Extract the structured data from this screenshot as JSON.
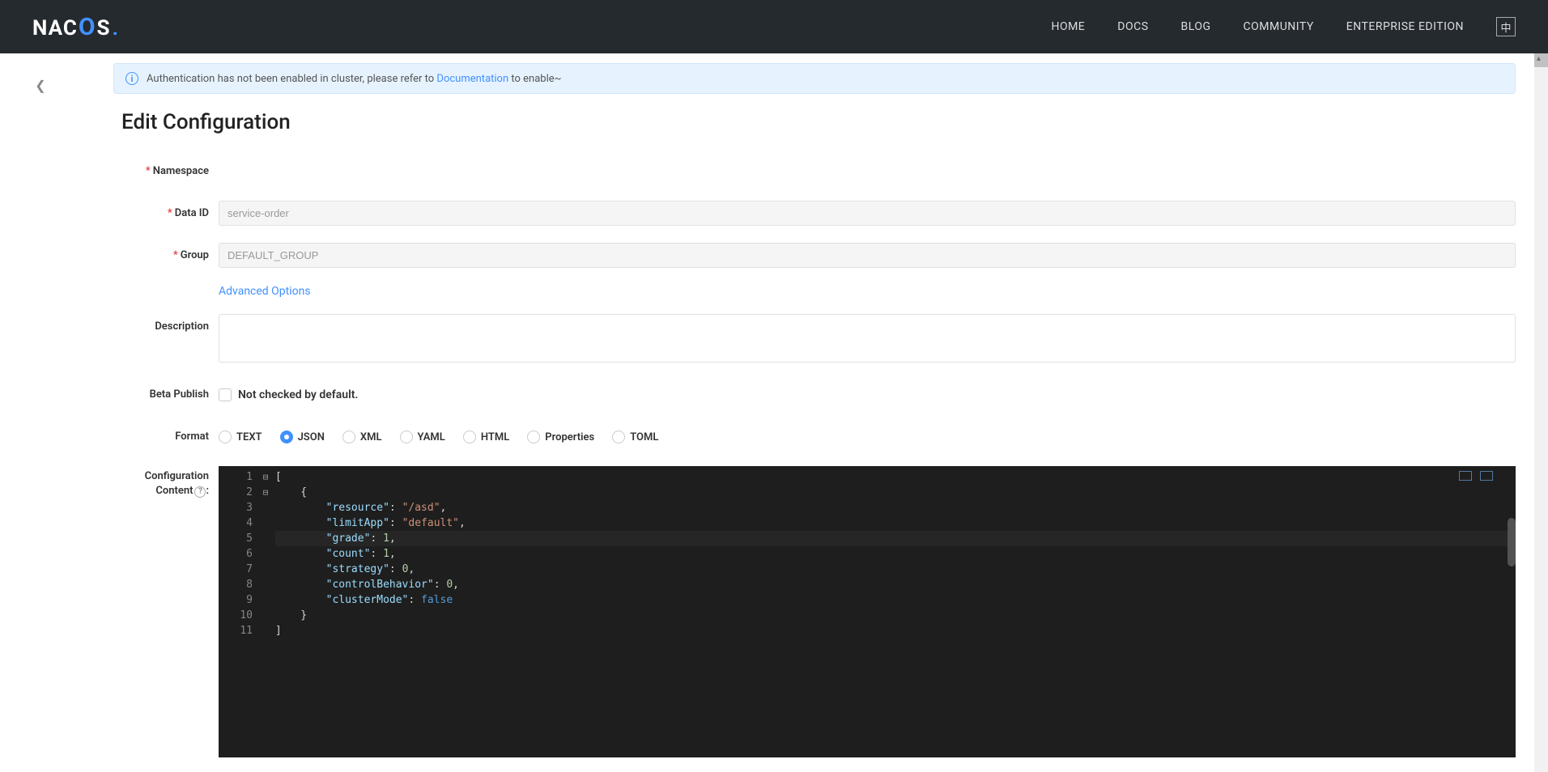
{
  "brand": "NACOS",
  "nav": {
    "home": "HOME",
    "docs": "DOCS",
    "blog": "BLOG",
    "community": "COMMUNITY",
    "enterprise": "ENTERPRISE EDITION",
    "lang": "中"
  },
  "alert": {
    "prefix": "Authentication has not been enabled in cluster, please refer to ",
    "link": "Documentation",
    "suffix": " to enable~"
  },
  "page": {
    "title": "Edit Configuration"
  },
  "form": {
    "namespace_label": "Namespace",
    "dataid_label": "Data ID",
    "dataid_value": "service-order",
    "group_label": "Group",
    "group_value": "DEFAULT_GROUP",
    "advanced_link": "Advanced Options",
    "description_label": "Description",
    "description_value": "",
    "beta_label": "Beta Publish",
    "beta_hint": "Not checked by default.",
    "format_label": "Format",
    "formats": {
      "text": "TEXT",
      "json": "JSON",
      "xml": "XML",
      "yaml": "YAML",
      "html": "HTML",
      "properties": "Properties",
      "toml": "TOML",
      "selected": "json"
    },
    "content_label_line1": "Configuration",
    "content_label_line2": "Content",
    "help_char": "?"
  },
  "editor": {
    "gutter": [
      "1",
      "2",
      "3",
      "4",
      "5",
      "6",
      "7",
      "8",
      "9",
      "10",
      "11"
    ],
    "fold": [
      "⊟",
      "⊟",
      "",
      "",
      "",
      "",
      "",
      "",
      "",
      "",
      ""
    ],
    "config_value": [
      {
        "resource": "/asd",
        "limitApp": "default",
        "grade": 1,
        "count": 1,
        "strategy": 0,
        "controlBehavior": 0,
        "clusterMode": false
      }
    ],
    "lines": [
      [
        {
          "t": "[",
          "c": "punc"
        }
      ],
      [
        {
          "t": "    {",
          "c": "punc"
        }
      ],
      [
        {
          "t": "        ",
          "c": "punc"
        },
        {
          "t": "\"resource\"",
          "c": "key"
        },
        {
          "t": ": ",
          "c": "punc"
        },
        {
          "t": "\"/asd\"",
          "c": "str"
        },
        {
          "t": ",",
          "c": "punc"
        }
      ],
      [
        {
          "t": "        ",
          "c": "punc"
        },
        {
          "t": "\"limitApp\"",
          "c": "key"
        },
        {
          "t": ": ",
          "c": "punc"
        },
        {
          "t": "\"default\"",
          "c": "str"
        },
        {
          "t": ",",
          "c": "punc"
        }
      ],
      [
        {
          "t": "        ",
          "c": "punc"
        },
        {
          "t": "\"grade\"",
          "c": "key"
        },
        {
          "t": ": ",
          "c": "punc"
        },
        {
          "t": "1",
          "c": "num"
        },
        {
          "t": ",",
          "c": "punc"
        }
      ],
      [
        {
          "t": "        ",
          "c": "punc"
        },
        {
          "t": "\"count\"",
          "c": "key"
        },
        {
          "t": ": ",
          "c": "punc"
        },
        {
          "t": "1",
          "c": "num"
        },
        {
          "t": ",",
          "c": "punc"
        }
      ],
      [
        {
          "t": "        ",
          "c": "punc"
        },
        {
          "t": "\"strategy\"",
          "c": "key"
        },
        {
          "t": ": ",
          "c": "punc"
        },
        {
          "t": "0",
          "c": "num"
        },
        {
          "t": ",",
          "c": "punc"
        }
      ],
      [
        {
          "t": "        ",
          "c": "punc"
        },
        {
          "t": "\"controlBehavior\"",
          "c": "key"
        },
        {
          "t": ": ",
          "c": "punc"
        },
        {
          "t": "0",
          "c": "num"
        },
        {
          "t": ",",
          "c": "punc"
        }
      ],
      [
        {
          "t": "        ",
          "c": "punc"
        },
        {
          "t": "\"clusterMode\"",
          "c": "key"
        },
        {
          "t": ": ",
          "c": "punc"
        },
        {
          "t": "false",
          "c": "bool"
        }
      ],
      [
        {
          "t": "    }",
          "c": "punc"
        }
      ],
      [
        {
          "t": "]",
          "c": "punc"
        }
      ]
    ],
    "current_line_index": 4
  }
}
